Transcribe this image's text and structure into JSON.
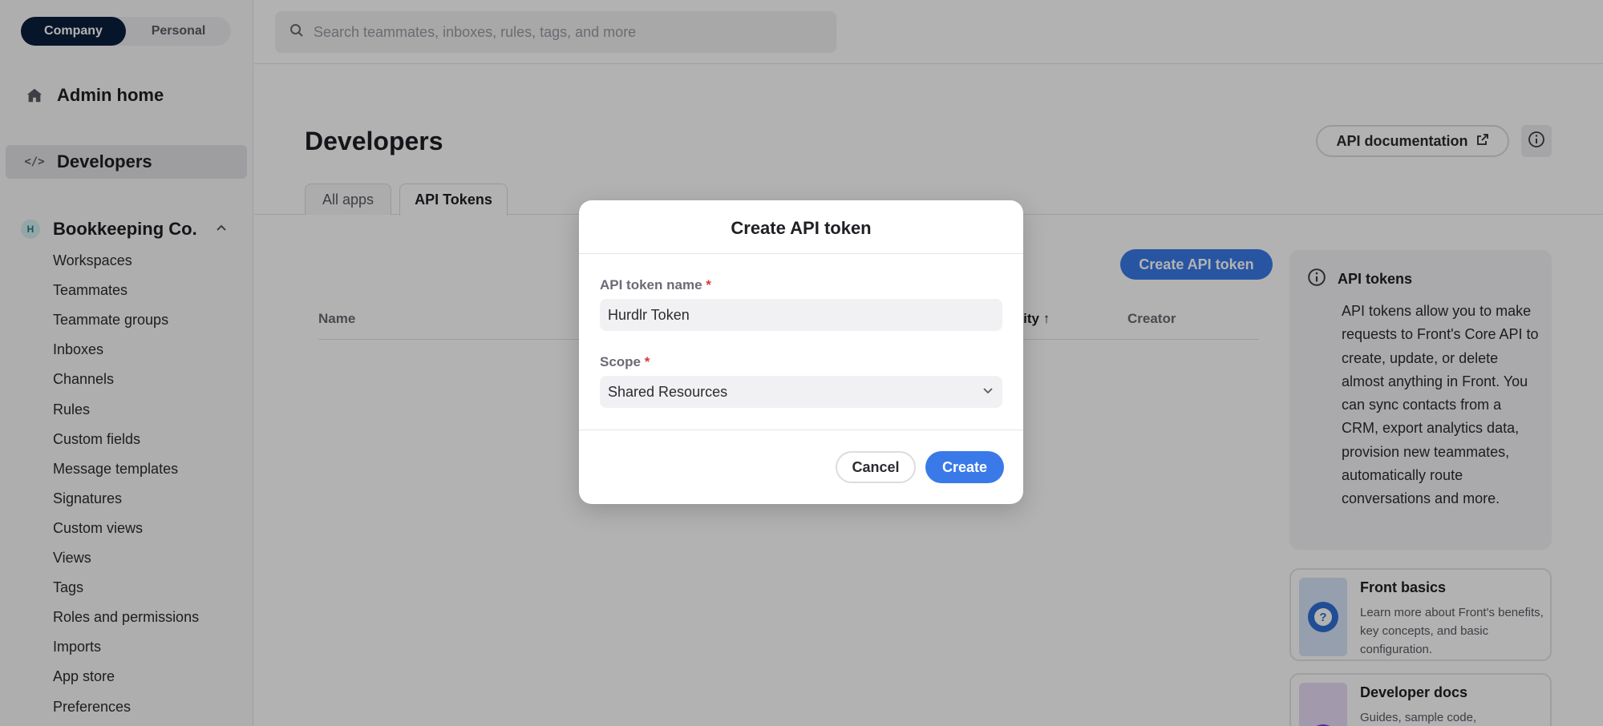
{
  "sidebar": {
    "switch": {
      "company": "Company",
      "personal": "Personal"
    },
    "admin_home": "Admin home",
    "developers": "Developers",
    "org": {
      "badge": "H",
      "name": "Bookkeeping Co."
    },
    "items": [
      "Workspaces",
      "Teammates",
      "Teammate groups",
      "Inboxes",
      "Channels",
      "Rules",
      "Custom fields",
      "Message templates",
      "Signatures",
      "Custom views",
      "Views",
      "Tags",
      "Roles and permissions",
      "Imports",
      "App store",
      "Preferences"
    ],
    "dev_glyph": "</>"
  },
  "search": {
    "placeholder": "Search teammates, inboxes, rules, tags, and more"
  },
  "main": {
    "title": "Developers",
    "api_doc": "API documentation",
    "tabs": [
      "All apps",
      "API Tokens"
    ],
    "create_button": "Create API token",
    "table_headers": {
      "name": "Name",
      "activity": "ivity ↑",
      "creator": "Creator"
    }
  },
  "info_panel": {
    "title": "API tokens",
    "body": "API tokens allow you to make requests to Front's Core API to create, update, or delete almost anything in Front. You can sync contacts from a CRM, export analytics data, provision new teammates, automatically route conversations and more."
  },
  "resources": [
    {
      "title": "Front basics",
      "desc": "Learn more about Front's benefits, key concepts, and basic configuration.",
      "glyph": "?"
    },
    {
      "title": "Developer docs",
      "desc": "Guides, sample code,",
      "glyph": "</>"
    }
  ],
  "modal": {
    "title": "Create API token",
    "name_label": "API token name",
    "name_value": "Hurdlr Token",
    "scope_label": "Scope",
    "scope_value": "Shared Resources",
    "required_mark": "*",
    "cancel": "Cancel",
    "create": "Create"
  },
  "colors": {
    "primary": "#3a7ae8",
    "nav_dark": "#0b1f3d",
    "required": "#d63b3b"
  }
}
